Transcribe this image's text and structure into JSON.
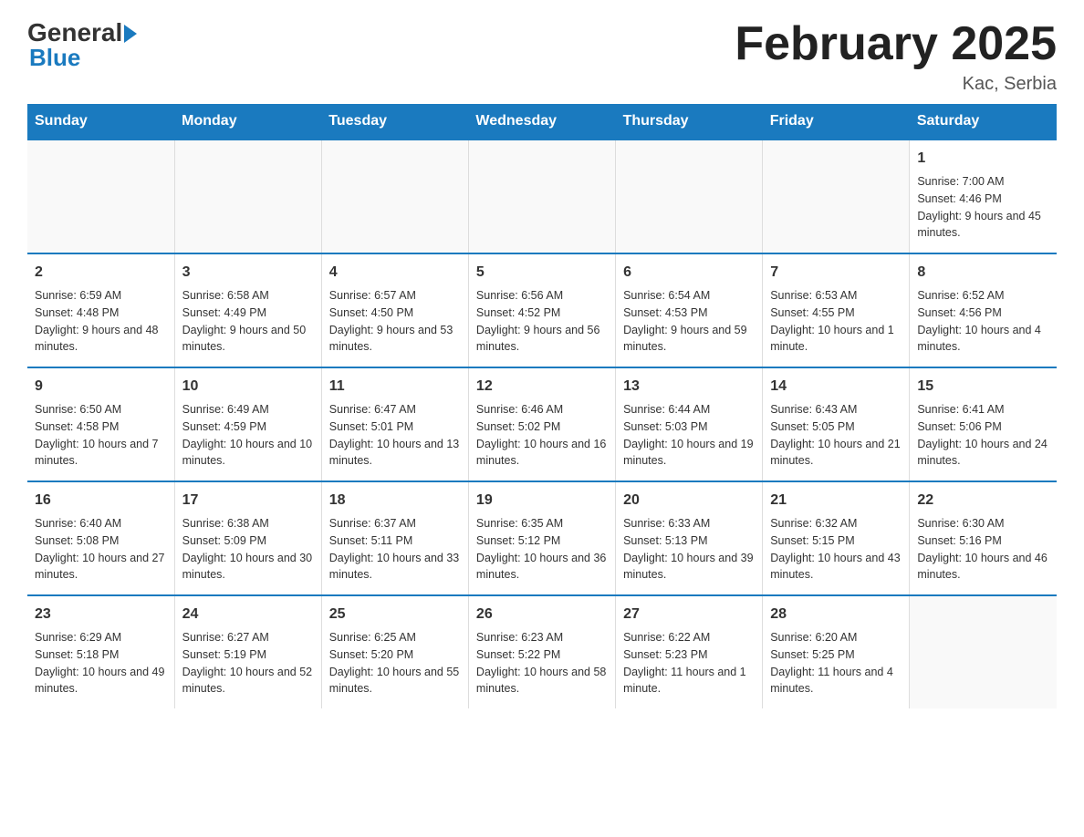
{
  "logo": {
    "text_general": "General",
    "text_blue": "Blue"
  },
  "title": "February 2025",
  "subtitle": "Kac, Serbia",
  "weekdays": [
    "Sunday",
    "Monday",
    "Tuesday",
    "Wednesday",
    "Thursday",
    "Friday",
    "Saturday"
  ],
  "weeks": [
    [
      null,
      null,
      null,
      null,
      null,
      null,
      {
        "day": "1",
        "sunrise": "Sunrise: 7:00 AM",
        "sunset": "Sunset: 4:46 PM",
        "daylight": "Daylight: 9 hours and 45 minutes."
      }
    ],
    [
      {
        "day": "2",
        "sunrise": "Sunrise: 6:59 AM",
        "sunset": "Sunset: 4:48 PM",
        "daylight": "Daylight: 9 hours and 48 minutes."
      },
      {
        "day": "3",
        "sunrise": "Sunrise: 6:58 AM",
        "sunset": "Sunset: 4:49 PM",
        "daylight": "Daylight: 9 hours and 50 minutes."
      },
      {
        "day": "4",
        "sunrise": "Sunrise: 6:57 AM",
        "sunset": "Sunset: 4:50 PM",
        "daylight": "Daylight: 9 hours and 53 minutes."
      },
      {
        "day": "5",
        "sunrise": "Sunrise: 6:56 AM",
        "sunset": "Sunset: 4:52 PM",
        "daylight": "Daylight: 9 hours and 56 minutes."
      },
      {
        "day": "6",
        "sunrise": "Sunrise: 6:54 AM",
        "sunset": "Sunset: 4:53 PM",
        "daylight": "Daylight: 9 hours and 59 minutes."
      },
      {
        "day": "7",
        "sunrise": "Sunrise: 6:53 AM",
        "sunset": "Sunset: 4:55 PM",
        "daylight": "Daylight: 10 hours and 1 minute."
      },
      {
        "day": "8",
        "sunrise": "Sunrise: 6:52 AM",
        "sunset": "Sunset: 4:56 PM",
        "daylight": "Daylight: 10 hours and 4 minutes."
      }
    ],
    [
      {
        "day": "9",
        "sunrise": "Sunrise: 6:50 AM",
        "sunset": "Sunset: 4:58 PM",
        "daylight": "Daylight: 10 hours and 7 minutes."
      },
      {
        "day": "10",
        "sunrise": "Sunrise: 6:49 AM",
        "sunset": "Sunset: 4:59 PM",
        "daylight": "Daylight: 10 hours and 10 minutes."
      },
      {
        "day": "11",
        "sunrise": "Sunrise: 6:47 AM",
        "sunset": "Sunset: 5:01 PM",
        "daylight": "Daylight: 10 hours and 13 minutes."
      },
      {
        "day": "12",
        "sunrise": "Sunrise: 6:46 AM",
        "sunset": "Sunset: 5:02 PM",
        "daylight": "Daylight: 10 hours and 16 minutes."
      },
      {
        "day": "13",
        "sunrise": "Sunrise: 6:44 AM",
        "sunset": "Sunset: 5:03 PM",
        "daylight": "Daylight: 10 hours and 19 minutes."
      },
      {
        "day": "14",
        "sunrise": "Sunrise: 6:43 AM",
        "sunset": "Sunset: 5:05 PM",
        "daylight": "Daylight: 10 hours and 21 minutes."
      },
      {
        "day": "15",
        "sunrise": "Sunrise: 6:41 AM",
        "sunset": "Sunset: 5:06 PM",
        "daylight": "Daylight: 10 hours and 24 minutes."
      }
    ],
    [
      {
        "day": "16",
        "sunrise": "Sunrise: 6:40 AM",
        "sunset": "Sunset: 5:08 PM",
        "daylight": "Daylight: 10 hours and 27 minutes."
      },
      {
        "day": "17",
        "sunrise": "Sunrise: 6:38 AM",
        "sunset": "Sunset: 5:09 PM",
        "daylight": "Daylight: 10 hours and 30 minutes."
      },
      {
        "day": "18",
        "sunrise": "Sunrise: 6:37 AM",
        "sunset": "Sunset: 5:11 PM",
        "daylight": "Daylight: 10 hours and 33 minutes."
      },
      {
        "day": "19",
        "sunrise": "Sunrise: 6:35 AM",
        "sunset": "Sunset: 5:12 PM",
        "daylight": "Daylight: 10 hours and 36 minutes."
      },
      {
        "day": "20",
        "sunrise": "Sunrise: 6:33 AM",
        "sunset": "Sunset: 5:13 PM",
        "daylight": "Daylight: 10 hours and 39 minutes."
      },
      {
        "day": "21",
        "sunrise": "Sunrise: 6:32 AM",
        "sunset": "Sunset: 5:15 PM",
        "daylight": "Daylight: 10 hours and 43 minutes."
      },
      {
        "day": "22",
        "sunrise": "Sunrise: 6:30 AM",
        "sunset": "Sunset: 5:16 PM",
        "daylight": "Daylight: 10 hours and 46 minutes."
      }
    ],
    [
      {
        "day": "23",
        "sunrise": "Sunrise: 6:29 AM",
        "sunset": "Sunset: 5:18 PM",
        "daylight": "Daylight: 10 hours and 49 minutes."
      },
      {
        "day": "24",
        "sunrise": "Sunrise: 6:27 AM",
        "sunset": "Sunset: 5:19 PM",
        "daylight": "Daylight: 10 hours and 52 minutes."
      },
      {
        "day": "25",
        "sunrise": "Sunrise: 6:25 AM",
        "sunset": "Sunset: 5:20 PM",
        "daylight": "Daylight: 10 hours and 55 minutes."
      },
      {
        "day": "26",
        "sunrise": "Sunrise: 6:23 AM",
        "sunset": "Sunset: 5:22 PM",
        "daylight": "Daylight: 10 hours and 58 minutes."
      },
      {
        "day": "27",
        "sunrise": "Sunrise: 6:22 AM",
        "sunset": "Sunset: 5:23 PM",
        "daylight": "Daylight: 11 hours and 1 minute."
      },
      {
        "day": "28",
        "sunrise": "Sunrise: 6:20 AM",
        "sunset": "Sunset: 5:25 PM",
        "daylight": "Daylight: 11 hours and 4 minutes."
      },
      null
    ]
  ]
}
